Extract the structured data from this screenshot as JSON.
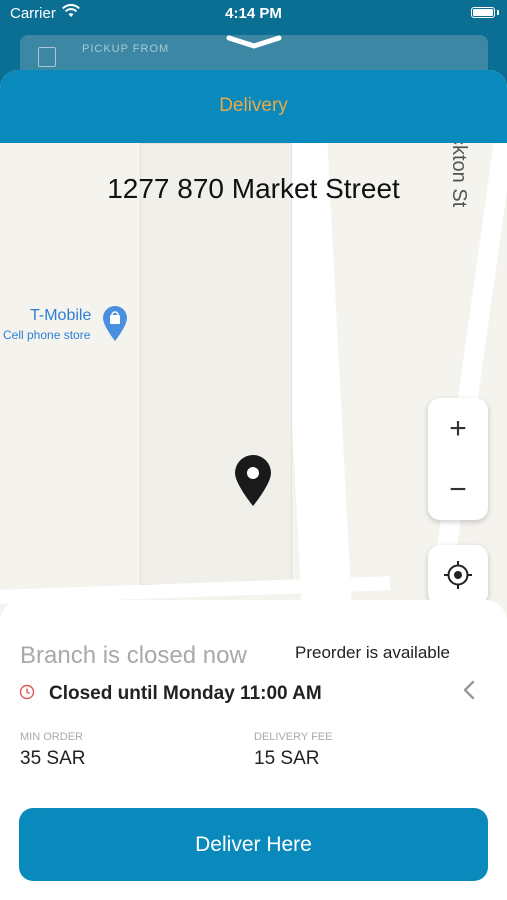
{
  "status_bar": {
    "carrier": "Carrier",
    "time": "4:14 PM"
  },
  "pickup": {
    "label": "PICKUP FROM"
  },
  "header": {
    "title": "Delivery"
  },
  "map": {
    "address": "1277 870 Market Street",
    "street_label": "ckton St",
    "poi": {
      "name": "T-Mobile",
      "type": "Cell phone store"
    },
    "zoom_in": "+",
    "zoom_out": "−"
  },
  "branch": {
    "status": "Branch is closed now",
    "preorder": "Preorder is available",
    "closed_until": "Closed until Monday 11:00 AM"
  },
  "order": {
    "min_label": "MIN ORDER",
    "min_value": "35 SAR",
    "fee_label": "DELIVERY FEE",
    "fee_value": "15 SAR"
  },
  "action": {
    "deliver_label": "Deliver Here"
  },
  "colors": {
    "primary": "#0a8abc",
    "title_accent": "#e8a94a",
    "closed_red": "#e05555",
    "poi_blue": "#2d7fd6"
  }
}
